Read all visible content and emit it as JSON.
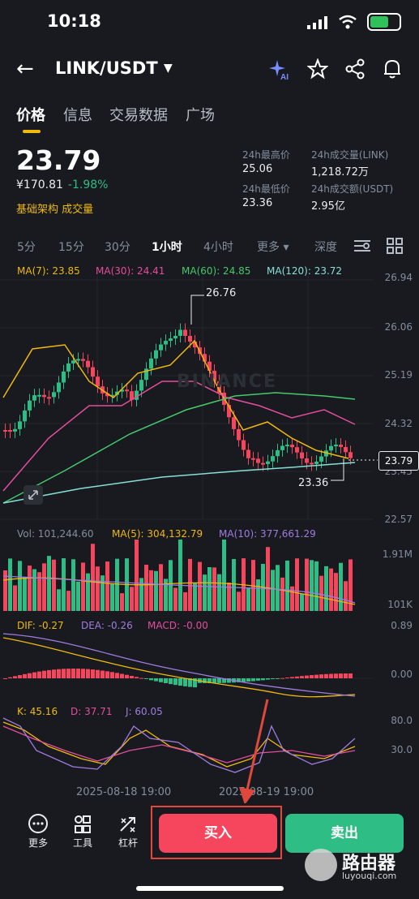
{
  "status": {
    "time": "10:18"
  },
  "header": {
    "back": "←",
    "title": "LINK/USDT",
    "caret": "▼",
    "ai_icon": "✦",
    "star_icon": "☆",
    "share_icon": "⋄",
    "bell_icon": "🔔"
  },
  "tabs": [
    {
      "label": "价格",
      "active": true
    },
    {
      "label": "信息",
      "active": false
    },
    {
      "label": "交易数据",
      "active": false
    },
    {
      "label": "广场",
      "active": false
    }
  ],
  "ticker": {
    "price": "23.79",
    "fiat": "¥170.81",
    "change": "-1.98%",
    "tags": "基础架构  成交量",
    "high_label": "24h最高价",
    "high": "25.06",
    "low_label": "24h最低价",
    "low": "23.36",
    "vol_label": "24h成交量(LINK)",
    "vol": "1,218.72万",
    "amt_label": "24h成交额(USDT)",
    "amt": "2.95亿"
  },
  "timeframes": [
    {
      "label": "5分"
    },
    {
      "label": "15分"
    },
    {
      "label": "30分"
    },
    {
      "label": "1小时",
      "active": true
    },
    {
      "label": "4小时"
    },
    {
      "label": "更多 ▾"
    },
    {
      "label": "深度"
    }
  ],
  "ma_legend": {
    "ma7": "MA(7): 23.85",
    "ma30": "MA(30): 24.41",
    "ma60": "MA(60): 24.85",
    "ma120": "MA(120): 23.72"
  },
  "price_axis": [
    "26.94",
    "26.06",
    "25.19",
    "24.32",
    "23.45",
    "22.57"
  ],
  "high_mark": "26.76",
  "low_mark": "23.36",
  "last_price_tag": "23.79",
  "watermark_chart": "BINANCE",
  "vol_legend": {
    "vol": "Vol: 101,244.60",
    "ma5": "MA(5): 304,132.79",
    "ma10": "MA(10): 377,661.29"
  },
  "vol_axis": [
    "1.91M",
    "101K"
  ],
  "macd_legend": {
    "dif": "DIF: -0.27",
    "dea": "DEA: -0.26",
    "macd": "MACD: -0.00"
  },
  "macd_axis": [
    "0.89",
    "0.00"
  ],
  "kdj_legend": {
    "k": "K: 45.16",
    "d": "D: 37.71",
    "j": "J: 60.05"
  },
  "kdj_axis": [
    "80.0",
    "30.0"
  ],
  "time_axis": [
    "2025-08-18 19:00",
    "2025-08-19 19:00"
  ],
  "toolbar": {
    "more": "更多",
    "tools": "工具",
    "leverage": "杠杆",
    "buy": "买入",
    "sell": "卖出"
  },
  "site_watermark": {
    "name": "路由器",
    "url": "luyouqi.com"
  },
  "colors": {
    "up": "#2ebd85",
    "down": "#f6465d",
    "ma7": "#f0b90b",
    "ma30": "#e64d9c",
    "ma60": "#46c96b",
    "ma120": "#86e0d6",
    "accent": "#f0b90b"
  }
}
